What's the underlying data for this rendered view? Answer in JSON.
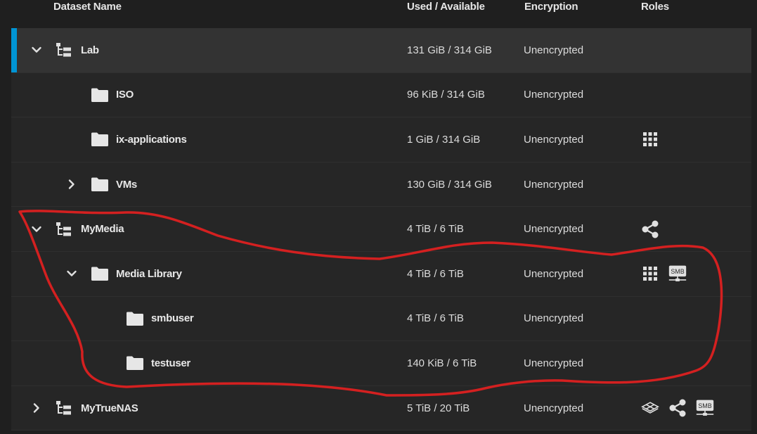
{
  "columns": {
    "name": "Dataset Name",
    "used": "Used / Available",
    "encryption": "Encryption",
    "roles": "Roles"
  },
  "rows": [
    {
      "name": "Lab",
      "used": "131 GiB / 314 GiB",
      "encryption": "Unencrypted",
      "level": 0,
      "type": "pool",
      "expander": "expanded",
      "selected": true,
      "roles": []
    },
    {
      "name": "ISO",
      "used": "96 KiB / 314 GiB",
      "encryption": "Unencrypted",
      "level": 1,
      "type": "folder",
      "expander": "none",
      "roles": []
    },
    {
      "name": "ix-applications",
      "used": "1 GiB / 314 GiB",
      "encryption": "Unencrypted",
      "level": 1,
      "type": "folder",
      "expander": "none",
      "roles": [
        "apps-grid-icon"
      ]
    },
    {
      "name": "VMs",
      "used": "130 GiB / 314 GiB",
      "encryption": "Unencrypted",
      "level": 1,
      "type": "folder",
      "expander": "collapsed",
      "roles": []
    },
    {
      "name": "MyMedia",
      "used": "4 TiB / 6 TiB",
      "encryption": "Unencrypted",
      "level": 0,
      "type": "pool",
      "expander": "expanded",
      "roles": [
        "share-icon"
      ]
    },
    {
      "name": "Media Library",
      "used": "4 TiB / 6 TiB",
      "encryption": "Unencrypted",
      "level": 1,
      "type": "folder",
      "expander": "expanded",
      "roles": [
        "apps-grid-icon",
        "smb-share-icon"
      ]
    },
    {
      "name": "smbuser",
      "used": "4 TiB / 6 TiB",
      "encryption": "Unencrypted",
      "level": 2,
      "type": "folder",
      "expander": "none",
      "roles": []
    },
    {
      "name": "testuser",
      "used": "140 KiB / 6 TiB",
      "encryption": "Unencrypted",
      "level": 2,
      "type": "folder",
      "expander": "none",
      "roles": []
    },
    {
      "name": "MyTrueNAS",
      "used": "5 TiB / 20 TiB",
      "encryption": "Unencrypted",
      "level": 0,
      "type": "pool",
      "expander": "collapsed",
      "roles": [
        "network-icon",
        "share-icon",
        "smb-share-icon"
      ]
    }
  ],
  "smb_label": "SMB",
  "colors": {
    "selected_accent": "#0095d5",
    "annotation": "#d42020",
    "row_bg": "#262626",
    "selected_bg": "#333333"
  }
}
